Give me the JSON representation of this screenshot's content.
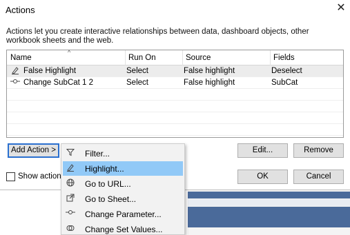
{
  "dialog": {
    "title": "Actions",
    "description": "Actions let you create interactive relationships between data, dashboard objects, other workbook sheets and the web."
  },
  "table": {
    "columns": [
      "Name",
      "Run On",
      "Source",
      "Fields"
    ],
    "rows": [
      {
        "icon": "highlight-icon",
        "name": "False Highlight",
        "run_on": "Select",
        "source": "False highlight",
        "fields": "Deselect"
      },
      {
        "icon": "parameter-icon",
        "name": "Change SubCat 1 2",
        "run_on": "Select",
        "source": "False highlight",
        "fields": "SubCat"
      }
    ]
  },
  "buttons": {
    "add_action": "Add Action >",
    "edit": "Edit...",
    "remove": "Remove",
    "ok": "OK",
    "cancel": "Cancel"
  },
  "checkbox": {
    "label": "Show actions",
    "checked": false
  },
  "menu": {
    "items": [
      {
        "icon": "filter-icon",
        "label": "Filter..."
      },
      {
        "icon": "highlight-icon",
        "label": "Highlight...",
        "highlighted": true
      },
      {
        "icon": "globe-icon",
        "label": "Go to URL..."
      },
      {
        "icon": "external-link-icon",
        "label": "Go to Sheet..."
      },
      {
        "icon": "parameter-icon",
        "label": "Change Parameter..."
      },
      {
        "icon": "set-icon",
        "label": "Change Set Values..."
      }
    ]
  },
  "colors": {
    "highlight": "#91c9f7",
    "focus_border": "#2a6fcf",
    "chart_bar": "#4a6a9a"
  }
}
